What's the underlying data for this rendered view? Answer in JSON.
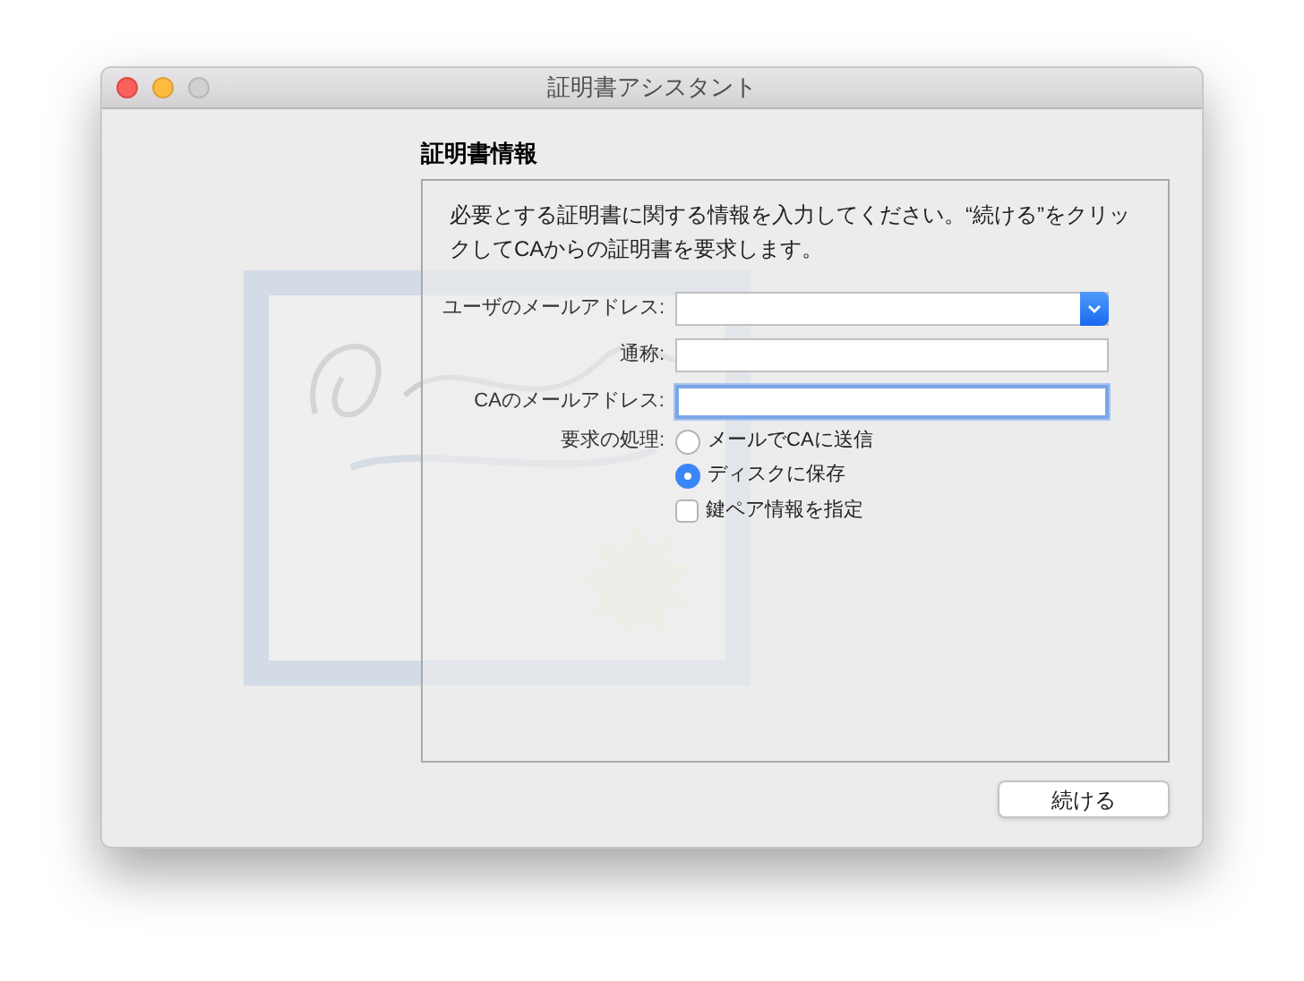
{
  "window": {
    "title": "証明書アシスタント"
  },
  "heading": "証明書情報",
  "description": "必要とする証明書に関する情報を入力してください。“続ける”をクリックしてCAからの証明書を要求します。",
  "fields": [
    {
      "label": "ユーザのメールアドレス:",
      "kind": "dropdown",
      "focused": false
    },
    {
      "label": "通称:",
      "kind": "text",
      "focused": false
    },
    {
      "label": "CAのメールアドレス:",
      "kind": "text",
      "focused": true
    }
  ],
  "request": {
    "label": "要求の処理:",
    "options": [
      {
        "label": "メールでCAに送信",
        "selected": false
      },
      {
        "label": "ディスクに保存",
        "selected": true
      }
    ]
  },
  "key_pair": {
    "label": "鍵ペア情報を指定",
    "checked": false
  },
  "continue_button": "続ける"
}
